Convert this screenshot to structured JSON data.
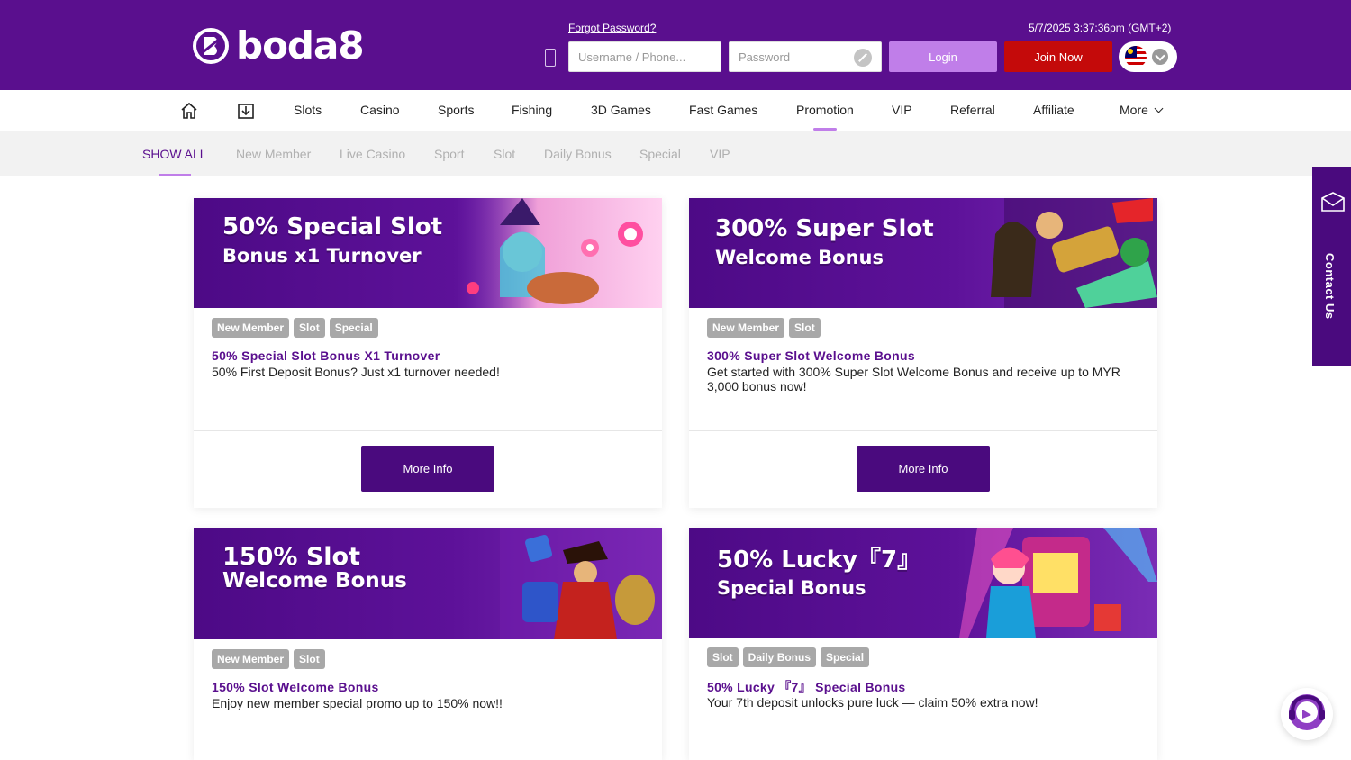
{
  "header": {
    "logo_text": "boda8",
    "forgot_password": "Forgot Password?",
    "datetime": "5/7/2025 3:37:36pm (GMT+2)",
    "username_placeholder": "Username / Phone...",
    "password_placeholder": "Password",
    "login_label": "Login",
    "join_label": "Join Now"
  },
  "nav": {
    "items": [
      "Slots",
      "Casino",
      "Sports",
      "Fishing",
      "3D Games",
      "Fast Games",
      "Promotion",
      "VIP",
      "Referral",
      "Affiliate",
      "More"
    ],
    "active": "Promotion"
  },
  "filters": {
    "items": [
      "SHOW ALL",
      "New Member",
      "Live Casino",
      "Sport",
      "Slot",
      "Daily Bonus",
      "Special",
      "VIP"
    ],
    "active": "SHOW ALL"
  },
  "promos": [
    {
      "banner_line1": "50% Special Slot",
      "banner_line2": "Bonus x1 Turnover",
      "tags": [
        "New Member",
        "Slot",
        "Special"
      ],
      "title": "50% Special Slot Bonus X1 Turnover",
      "desc": "50% First Deposit Bonus? Just x1 turnover needed!",
      "button": "More Info"
    },
    {
      "banner_line1": "300% Super Slot",
      "banner_line2": "Welcome Bonus",
      "tags": [
        "New Member",
        "Slot"
      ],
      "title": "300% Super Slot Welcome Bonus",
      "desc": "Get started with 300% Super Slot Welcome Bonus and receive up to MYR 3,000 bonus now!",
      "button": "More Info"
    },
    {
      "banner_line1": "150% Slot",
      "banner_line2": "Welcome Bonus",
      "tags": [
        "New Member",
        "Slot"
      ],
      "title": "150% Slot Welcome Bonus",
      "desc": "Enjoy new member special promo up to 150% now!!"
    },
    {
      "banner_line1": "50% Lucky『7』",
      "banner_line2": "Special Bonus",
      "tags": [
        "Slot",
        "Daily Bonus",
        "Special"
      ],
      "title": "50% Lucky 『7』 Special Bonus",
      "desc": "Your 7th deposit unlocks pure luck — claim 50% extra now!"
    }
  ],
  "contact_label": "Contact Us",
  "colors": {
    "brand_purple": "#5a0f8e",
    "button_purple": "#4a0a7e",
    "login_lilac": "#c07ee9",
    "join_red": "#c40a0a",
    "tag_grey": "#a8a8a8"
  }
}
